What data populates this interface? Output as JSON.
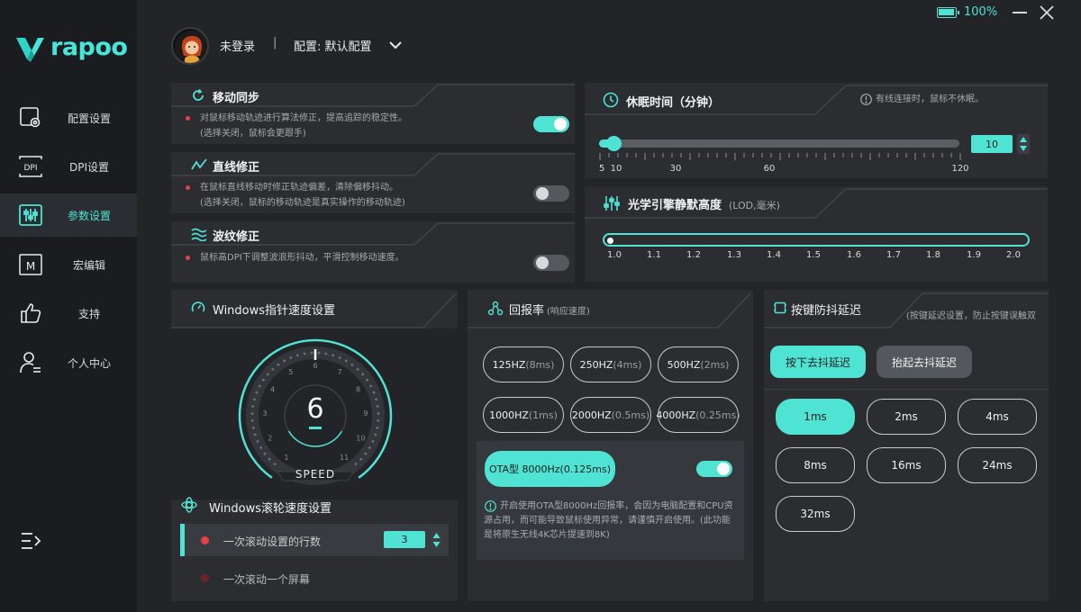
{
  "window": {
    "battery": "100%"
  },
  "brand": {
    "logo_text": "rapoo"
  },
  "sidebar": {
    "items": [
      {
        "label": "配置设置",
        "icon": "profile-settings-icon"
      },
      {
        "label": "DPI设置",
        "icon": "dpi-icon"
      },
      {
        "label": "参数设置",
        "icon": "parameters-icon",
        "active": true
      },
      {
        "label": "宏编辑",
        "icon": "macro-icon"
      },
      {
        "label": "支持",
        "icon": "thumbs-up-icon"
      },
      {
        "label": "个人中心",
        "icon": "user-center-icon"
      }
    ]
  },
  "header": {
    "user": "未登录",
    "separator": "|",
    "profile": "配置: 默认配置"
  },
  "motion_sync": {
    "title": "移动同步",
    "desc1": "对鼠标移动轨迹进行算法修正，提高追踪的稳定性。",
    "desc2": "(选择关闭，鼠标会更跟手)",
    "enabled": true
  },
  "angle_snap": {
    "title": "直线修正",
    "desc1": "在鼠标直线移动时修正轨迹偏差，清除偏移抖动。",
    "desc2": "(选择关闭，鼠标的移动轨迹是真实操作的移动轨迹)",
    "enabled": false
  },
  "ripple": {
    "title": "波纹修正",
    "desc1": "鼠标高DPI下调整波浪形抖动，平滑控制移动速度。",
    "enabled": false
  },
  "sleep": {
    "title": "休眠时间（分钟）",
    "note": "有线连接时，鼠标不休眠。",
    "value": "10",
    "ticks": [
      "5",
      "10",
      "30",
      "60",
      "120"
    ]
  },
  "lod": {
    "title": "光学引擎静默高度",
    "unit": "(LOD,毫米)",
    "ticks": [
      "1.0",
      "1.1",
      "1.2",
      "1.3",
      "1.4",
      "1.5",
      "1.6",
      "1.7",
      "1.8",
      "1.9",
      "2.0"
    ],
    "selected": "1.0"
  },
  "pointer": {
    "title": "Windows指针速度设置",
    "value": "6",
    "speed_label": "SPEED",
    "dial_numbers": [
      "1",
      "2",
      "3",
      "4",
      "5",
      "6",
      "7",
      "8",
      "9",
      "10",
      "11"
    ]
  },
  "scroll": {
    "title": "Windows滚轮速度设置",
    "option1": "一次滚动设置的行数",
    "lines": "3",
    "option2": "一次滚动一个屏幕"
  },
  "polling": {
    "title": "回报率",
    "subtitle": "(响应速度)",
    "rates": [
      {
        "main": "125HZ",
        "sub": "(8ms)"
      },
      {
        "main": "250HZ",
        "sub": "(4ms)"
      },
      {
        "main": "500HZ",
        "sub": "(2ms)"
      },
      {
        "main": "1000HZ",
        "sub": "(1ms)"
      },
      {
        "main": "2000HZ",
        "sub": "(0.5ms)"
      },
      {
        "main": "4000HZ",
        "sub": "(0.25ms)"
      }
    ],
    "ota_label": "OTA型 8000Hz(0.125ms)",
    "ota_enabled": true,
    "ota_note": "开启使用OTA型8000Hz回报率，会因为电脑配置和CPU资源占用，而可能导致鼠标使用异常，请谨慎开启使用。(此功能是将原生无线4K芯片提速到8K)"
  },
  "debounce": {
    "title": "按键防抖延迟",
    "note": "(按键延迟设置，防止按键误触双",
    "tab_press": "按下去抖延迟",
    "tab_release": "抬起去抖延迟",
    "options": [
      "1ms",
      "2ms",
      "4ms",
      "8ms",
      "16ms",
      "24ms",
      "32ms"
    ],
    "selected": "1ms"
  },
  "colors": {
    "accent": "#4fe3d4",
    "bg": "#222428",
    "panel": "#2b2d31",
    "sidebar": "#1a1c1f",
    "warn": "#e2404b"
  }
}
